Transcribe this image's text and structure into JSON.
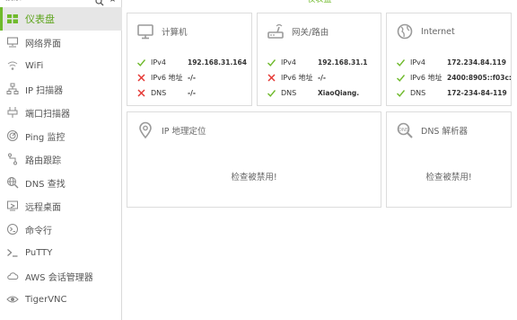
{
  "header": {
    "title": "仪表盘"
  },
  "search": {
    "placeholder": "搜索"
  },
  "sidebar": {
    "items": [
      {
        "label": "仪表盘",
        "icon": "dashboard-icon",
        "active": true
      },
      {
        "label": "网络界面",
        "icon": "monitor-network-icon"
      },
      {
        "label": "WiFi",
        "icon": "wifi-icon"
      },
      {
        "label": "IP 扫描器",
        "icon": "network-tree-icon"
      },
      {
        "label": "端口扫描器",
        "icon": "ethernet-port-icon"
      },
      {
        "label": "Ping 监控",
        "icon": "radar-icon"
      },
      {
        "label": "路由跟踪",
        "icon": "route-icon"
      },
      {
        "label": "DNS 查找",
        "icon": "globe-search-icon"
      },
      {
        "label": "远程桌面",
        "icon": "remote-desktop-icon"
      },
      {
        "label": "命令行",
        "icon": "console-icon"
      },
      {
        "label": "PuTTY",
        "icon": "terminal-icon"
      },
      {
        "label": "AWS 会话管理器",
        "icon": "cloud-icon"
      },
      {
        "label": "TigerVNC",
        "icon": "eye-icon"
      }
    ]
  },
  "cards": {
    "computer": {
      "title": "计算机",
      "rows": [
        {
          "label": "IPv4",
          "value": "192.168.31.164",
          "status": "ok"
        },
        {
          "label": "IPv6 地址",
          "value": "-/-",
          "status": "error"
        },
        {
          "label": "DNS",
          "value": "-/-",
          "status": "error"
        }
      ]
    },
    "router": {
      "title": "网关/路由",
      "rows": [
        {
          "label": "IPv4",
          "value": "192.168.31.1",
          "status": "ok"
        },
        {
          "label": "IPv6 地址",
          "value": "-/-",
          "status": "error"
        },
        {
          "label": "DNS",
          "value": "XiaoQiang.",
          "status": "ok"
        }
      ]
    },
    "internet": {
      "title": "Internet",
      "rows": [
        {
          "label": "IPv4",
          "value": "172.234.84.119",
          "status": "ok"
        },
        {
          "label": "IPv6 地址",
          "value": "2400:8905::f03c:",
          "status": "ok"
        },
        {
          "label": "DNS",
          "value": "172-234-84-119",
          "status": "ok"
        }
      ]
    },
    "geo": {
      "title": "IP 地理定位",
      "message": "检查被禁用!"
    },
    "dns": {
      "title": "DNS 解析器",
      "message": "检查被禁用!"
    }
  },
  "colors": {
    "accent": "#6fba2c",
    "error": "#e53935",
    "border": "#dcdcdc",
    "icon": "#9a9a9a"
  }
}
